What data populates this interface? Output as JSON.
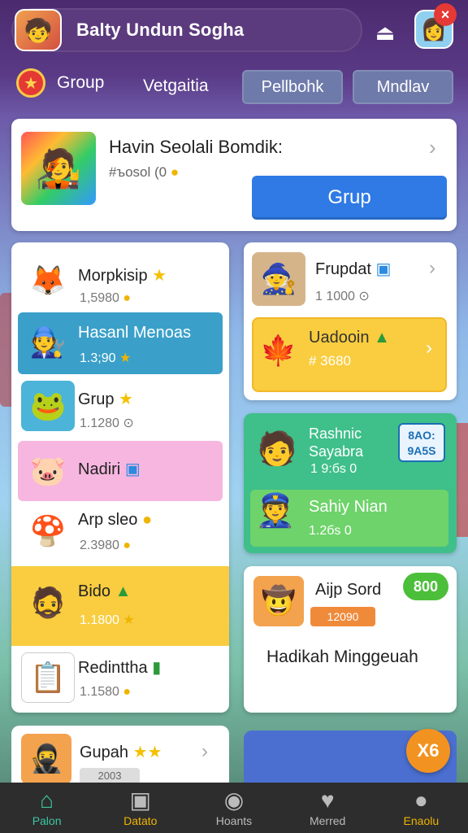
{
  "header": {
    "title": "Balty Undun Sogha"
  },
  "tabs": {
    "group": "Group",
    "plain": "Vetgaitia",
    "pill_a": "Pellbohk",
    "pill_b": "Mndlav"
  },
  "featured": {
    "title": "Havin Seolali Bomdik:",
    "sub": "#ъosol (0",
    "button": "Grup"
  },
  "left_list": [
    {
      "name": "Morpkisip",
      "value": "1,5980"
    },
    {
      "name": "Hasanl Menoas",
      "value": "1.3;90"
    },
    {
      "name": "Grup",
      "value": "1.1280"
    },
    {
      "name": "Nadiri",
      "value": ""
    },
    {
      "name": "Arp sleo",
      "value": "2.3980"
    },
    {
      "name": "Bido",
      "value": "1.1800"
    },
    {
      "name": "Redinttha",
      "value": "1.1580"
    }
  ],
  "right_card1": {
    "title": "Frupdat",
    "value": "1 1000",
    "button_title": "Uadooin",
    "button_value": "# 3680"
  },
  "right_card2": {
    "title_line1": "Rashnic",
    "title_line2": "Sayabra",
    "value": "1 9:бs 0",
    "tag_line1": "8AO:",
    "tag_line2": "9A5S",
    "sub_title": "Sahiy Nian",
    "sub_value": "1.2бs 0"
  },
  "right_card3": {
    "title": "Aijp Sord",
    "value": "12090",
    "badge": "800",
    "body": "Hadikah Minggeuah"
  },
  "bottom_left": {
    "title": "Gupah",
    "tag": "2003"
  },
  "fab": {
    "label": "X6"
  },
  "nav": [
    {
      "label": "Palon",
      "icon": "home-icon"
    },
    {
      "label": "Datato",
      "icon": "calendar-icon"
    },
    {
      "label": "Hoants",
      "icon": "clock-icon"
    },
    {
      "label": "Merred",
      "icon": "heart-icon"
    },
    {
      "label": "Enaolu",
      "icon": "user-icon"
    }
  ]
}
